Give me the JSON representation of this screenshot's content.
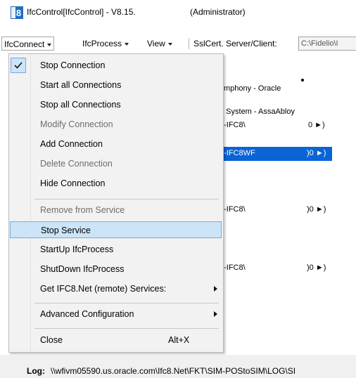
{
  "window": {
    "title": "IfcControl[IfcControl] - V8.15.",
    "admin": "(Administrator)",
    "icon_text": "8"
  },
  "menubar": {
    "items": [
      {
        "label": "IfcConnect"
      },
      {
        "label": "IfcProcess"
      },
      {
        "label": "View"
      }
    ],
    "sslcert_label": "SslCert. Server/Client:",
    "path_value": "C:\\Fidelio\\I"
  },
  "background": {
    "lines": [
      "mphony - Oracle",
      "g System - AssaAbloy",
      "e-IFC8\\",
      "0 ►)",
      "e-IFC8WF",
      ")0 ►)",
      "e-IFC8\\",
      ")0 ►)",
      "e-IFC8\\",
      ")0 ►)"
    ]
  },
  "popup_menu": {
    "items": [
      {
        "label": "Stop Connection",
        "checked": true,
        "disabled": false
      },
      {
        "label": "Start all Connections",
        "disabled": false
      },
      {
        "label": "Stop all Connections",
        "disabled": false
      },
      {
        "label": "Modify Connection",
        "disabled": true
      },
      {
        "label": "Add Connection",
        "disabled": false
      },
      {
        "label": "Delete Connection",
        "disabled": true
      },
      {
        "label": "Hide Connection",
        "disabled": false
      },
      {
        "label": "Remove from Service",
        "disabled": true
      },
      {
        "label": "Stop Service",
        "disabled": false,
        "hover": true
      },
      {
        "label": "StartUp IfcProcess",
        "disabled": false
      },
      {
        "label": "ShutDown IfcProcess",
        "disabled": false
      },
      {
        "label": "Get IFC8.Net (remote) Services:",
        "disabled": false,
        "submenu": true
      },
      {
        "label": "Advanced Configuration",
        "disabled": false,
        "submenu": true
      },
      {
        "label": "Close",
        "disabled": false,
        "shortcut": "Alt+X"
      }
    ]
  },
  "log": {
    "label": "Log:",
    "path": "\\\\wfivm05590.us.oracle.com\\Ifc8.Net\\FKT\\SIM-POStoSIM\\LOG\\SI"
  },
  "colors": {
    "selection": "#0a64d6",
    "hover_bg": "#cce4f7",
    "hover_border": "#7aa9d6",
    "menu_bg": "#f2f2f2",
    "app_icon": "#1f6fbf"
  }
}
